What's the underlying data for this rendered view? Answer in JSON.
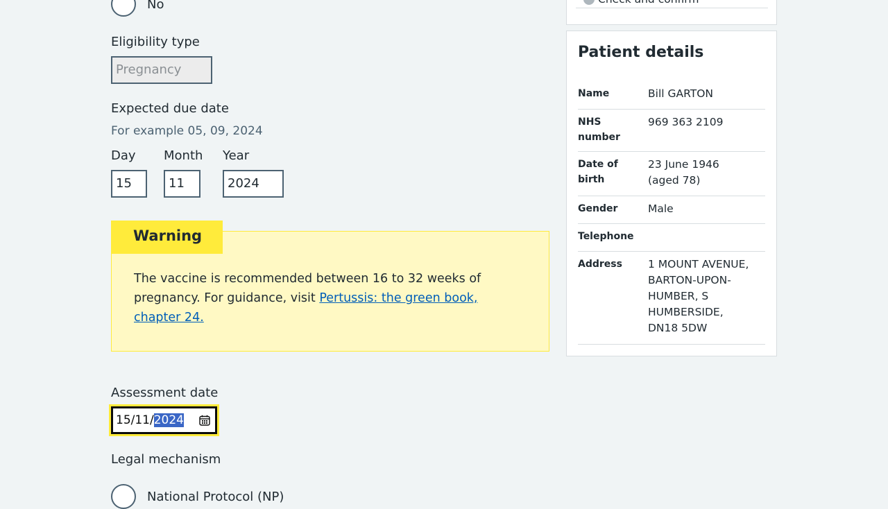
{
  "radio_top": {
    "label": "No"
  },
  "eligibility": {
    "label": "Eligibility type",
    "value": "Pregnancy"
  },
  "due_date": {
    "label": "Expected due date",
    "hint": "For example 05, 09, 2024",
    "day_label": "Day",
    "day_value": "15",
    "month_label": "Month",
    "month_value": "11",
    "year_label": "Year",
    "year_value": "2024"
  },
  "warning": {
    "heading": "Warning",
    "text": "The vaccine is recommended between 16 to 32 weeks of pregnancy. For guidance, visit ",
    "link": "Pertussis: the green book, chapter 24."
  },
  "assessment": {
    "label": "Assessment date",
    "value_prefix": "15/11/",
    "value_selected": "2024",
    "icon": "calendar-icon"
  },
  "legal": {
    "label": "Legal mechanism",
    "option1": "National Protocol (NP)"
  },
  "sidebar_top": {
    "item": "Check and confirm"
  },
  "patient": {
    "title": "Patient details",
    "rows": [
      {
        "key": "Name",
        "value": "Bill GARTON"
      },
      {
        "key": "NHS number",
        "value": "969 363 2109"
      },
      {
        "key": "Date of birth",
        "value": "23 June 1946 (aged 78)"
      },
      {
        "key": "Gender",
        "value": "Male"
      },
      {
        "key": "Telephone",
        "value": ""
      },
      {
        "key": "Address",
        "value": "1 MOUNT AVENUE, BARTON-UPON-HUMBER, S HUMBERSIDE, DN18 5DW"
      }
    ]
  },
  "colors": {
    "background": "#f0f4f5",
    "warning_heading": "#ffeb3b",
    "warning_body": "#fff9c4",
    "link": "#005eb8",
    "focus": "#ffeb3b",
    "selection": "#3a66c6"
  }
}
